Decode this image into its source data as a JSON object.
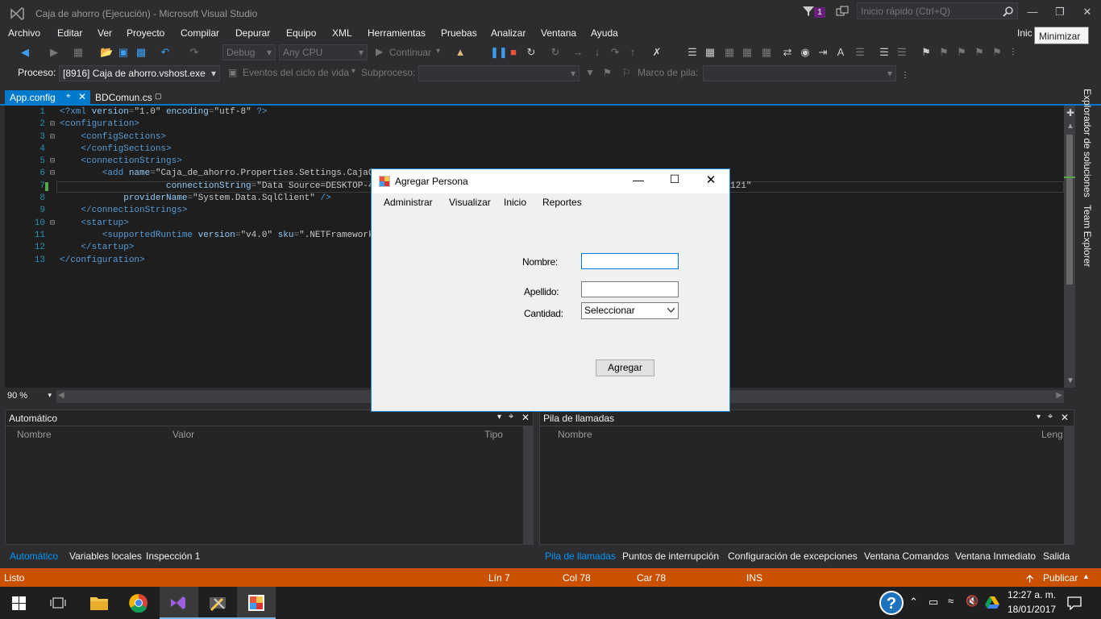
{
  "titlebar": {
    "title": "Caja de ahorro (Ejecución) - Microsoft Visual Studio",
    "notification_count": "1",
    "quick_launch_placeholder": "Inicio rápido (Ctrl+Q)",
    "user_label": "Inic",
    "tooltip": "Minimizar"
  },
  "menu": {
    "items": [
      "Archivo",
      "Editar",
      "Ver",
      "Proyecto",
      "Compilar",
      "Depurar",
      "Equipo",
      "XML",
      "Herramientas",
      "Pruebas",
      "Analizar",
      "Ventana",
      "Ayuda"
    ]
  },
  "toolbar": {
    "config": "Debug",
    "platform": "Any CPU",
    "continue_label": "Continuar",
    "process_label": "Proceso:",
    "process_value": "[8916] Caja de ahorro.vshost.exe",
    "lifecycle_label": "Eventos del ciclo de vida",
    "subprocess_label": "Subproceso:",
    "stack_frame_label": "Marco de pila:"
  },
  "tabs": [
    {
      "label": "App.config",
      "active": true
    },
    {
      "label": "BDComun.cs",
      "active": false
    }
  ],
  "editor": {
    "lines": [
      "1",
      "2",
      "3",
      "4",
      "5",
      "6",
      "7",
      "8",
      "9",
      "10",
      "11",
      "12",
      "13"
    ],
    "zoom": "90 %",
    "code_fragment_1": "Caja_de_ahorro.Properties.Settings.CajaCo",
    "code_fragment_2": "Data Source=DESKTOP-4",
    "code_fragment_3": "121\"",
    "code_fragment_4": "System.Data.SqlClient",
    "code_fragment_5": "v4.0",
    "code_fragment_6": ".NETFramework,"
  },
  "side_panels": [
    "Explorador de soluciones",
    "Team Explorer"
  ],
  "auto_pane": {
    "title": "Automático",
    "columns": [
      "Nombre",
      "Valor",
      "Tipo"
    ],
    "tabs": [
      "Automático",
      "Variables locales",
      "Inspección 1"
    ]
  },
  "callstack_pane": {
    "title": "Pila de llamadas",
    "columns": [
      "Nombre",
      "Leng"
    ],
    "tabs": [
      "Pila de llamadas",
      "Puntos de interrupción",
      "Configuración de excepciones",
      "Ventana Comandos",
      "Ventana Inmediato",
      "Salida"
    ]
  },
  "statusbar": {
    "state": "Listo",
    "line": "Lín 7",
    "col": "Col 78",
    "car": "Car 78",
    "ins": "INS",
    "publish": "Publicar"
  },
  "dialog": {
    "title": "Agregar Persona",
    "menu": [
      "Administrar",
      "Visualizar",
      "Inicio",
      "Reportes"
    ],
    "nombre_label": "Nombre:",
    "nombre_value": "",
    "apellido_label": "Apellido:",
    "apellido_value": "",
    "cantidad_label": "Cantidad:",
    "cantidad_selected": "Seleccionar",
    "agregar_button": "Agregar"
  },
  "taskbar": {
    "time": "12:27 a. m.",
    "date": "18/01/2017"
  },
  "colors": {
    "accent": "#007acc",
    "status_bar": "#ca5100",
    "editor_bg": "#1e1e1e",
    "xml_tag": "#569cd6"
  }
}
